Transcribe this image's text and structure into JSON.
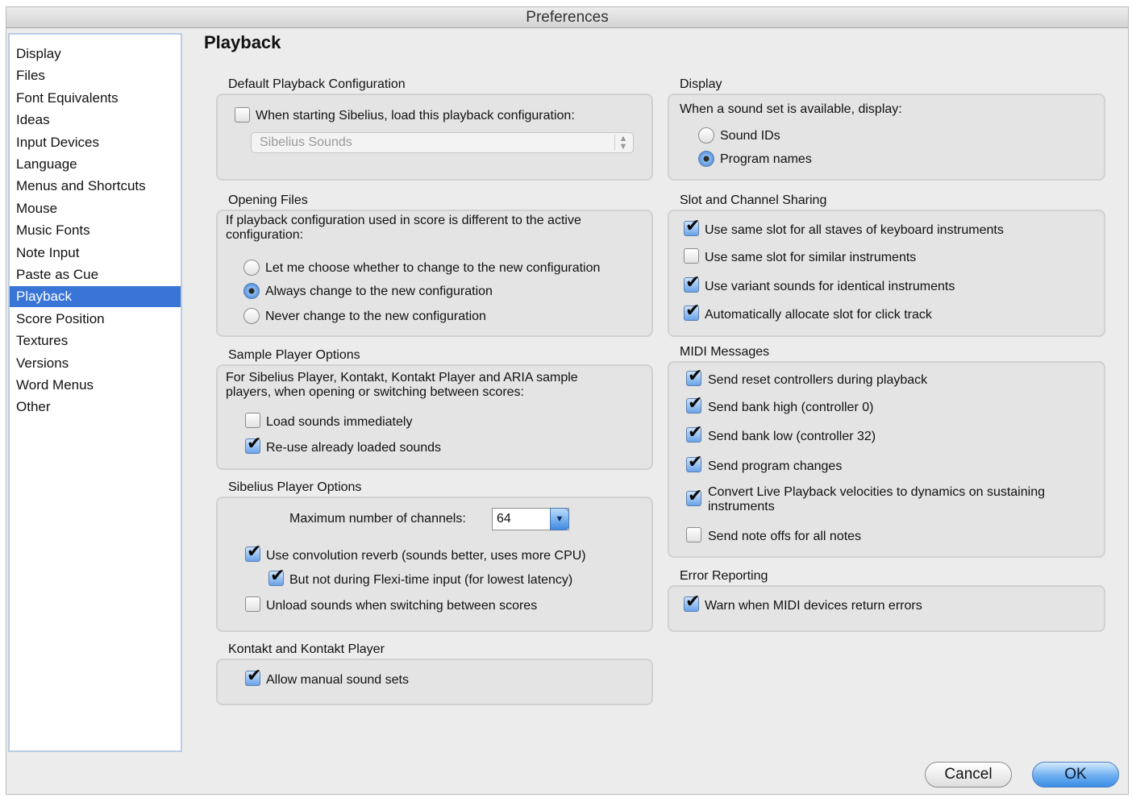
{
  "window": {
    "title": "Preferences"
  },
  "sidebar": {
    "items": [
      {
        "label": "Display",
        "selected": false
      },
      {
        "label": "Files",
        "selected": false
      },
      {
        "label": "Font Equivalents",
        "selected": false
      },
      {
        "label": "Ideas",
        "selected": false
      },
      {
        "label": "Input Devices",
        "selected": false
      },
      {
        "label": "Language",
        "selected": false
      },
      {
        "label": "Menus and Shortcuts",
        "selected": false
      },
      {
        "label": "Mouse",
        "selected": false
      },
      {
        "label": "Music Fonts",
        "selected": false
      },
      {
        "label": "Note Input",
        "selected": false
      },
      {
        "label": "Paste as Cue",
        "selected": false
      },
      {
        "label": "Playback",
        "selected": true
      },
      {
        "label": "Score Position",
        "selected": false
      },
      {
        "label": "Textures",
        "selected": false
      },
      {
        "label": "Versions",
        "selected": false
      },
      {
        "label": "Word Menus",
        "selected": false
      },
      {
        "label": "Other",
        "selected": false
      }
    ]
  },
  "page": {
    "title": "Playback"
  },
  "default_config": {
    "label": "Default Playback Configuration",
    "checkbox": {
      "label": "When starting Sibelius, load this playback configuration:",
      "checked": false
    },
    "popup_value": "Sibelius Sounds"
  },
  "opening_files": {
    "label": "Opening Files",
    "description": "If playback configuration used in score is different to the active configuration:",
    "options": [
      {
        "label": "Let me choose whether to change to the new configuration",
        "selected": false
      },
      {
        "label": "Always change to the new configuration",
        "selected": true
      },
      {
        "label": "Never change to the new configuration",
        "selected": false
      }
    ]
  },
  "sample_player": {
    "label": "Sample Player Options",
    "description": "For Sibelius Player, Kontakt, Kontakt Player and ARIA sample players, when opening or switching between scores:",
    "options": [
      {
        "label": "Load sounds immediately",
        "checked": false
      },
      {
        "label": "Re-use already loaded sounds",
        "checked": true
      }
    ]
  },
  "sibelius_player": {
    "label": "Sibelius Player Options",
    "channels_label": "Maximum number of channels:",
    "channels_value": "64",
    "options": [
      {
        "label": "Use convolution reverb (sounds better, uses more CPU)",
        "checked": true
      },
      {
        "label": "But not during Flexi-time input (for lowest latency)",
        "checked": true
      },
      {
        "label": "Unload sounds when switching between scores",
        "checked": false
      }
    ]
  },
  "kontakt": {
    "label": "Kontakt and Kontakt Player",
    "options": [
      {
        "label": "Allow manual sound sets",
        "checked": true
      }
    ]
  },
  "display": {
    "label": "Display",
    "description": "When a sound set is available, display:",
    "options": [
      {
        "label": "Sound IDs",
        "selected": false
      },
      {
        "label": "Program names",
        "selected": true
      }
    ]
  },
  "slot_sharing": {
    "label": "Slot and Channel Sharing",
    "options": [
      {
        "label": "Use same slot for all staves of keyboard instruments",
        "checked": true
      },
      {
        "label": "Use same slot for similar instruments",
        "checked": false
      },
      {
        "label": "Use variant sounds for identical instruments",
        "checked": true
      },
      {
        "label": "Automatically allocate slot for click track",
        "checked": true
      }
    ]
  },
  "midi": {
    "label": "MIDI Messages",
    "options": [
      {
        "label": "Send reset controllers during playback",
        "checked": true
      },
      {
        "label": "Send bank high (controller 0)",
        "checked": true
      },
      {
        "label": "Send bank low (controller 32)",
        "checked": true
      },
      {
        "label": "Send program changes",
        "checked": true
      },
      {
        "label": "Convert Live Playback velocities to dynamics on sustaining instruments",
        "checked": true
      },
      {
        "label": "Send note offs for all notes",
        "checked": false
      }
    ]
  },
  "error_reporting": {
    "label": "Error Reporting",
    "options": [
      {
        "label": "Warn when MIDI devices return errors",
        "checked": true
      }
    ]
  },
  "buttons": {
    "cancel": "Cancel",
    "ok": "OK"
  }
}
